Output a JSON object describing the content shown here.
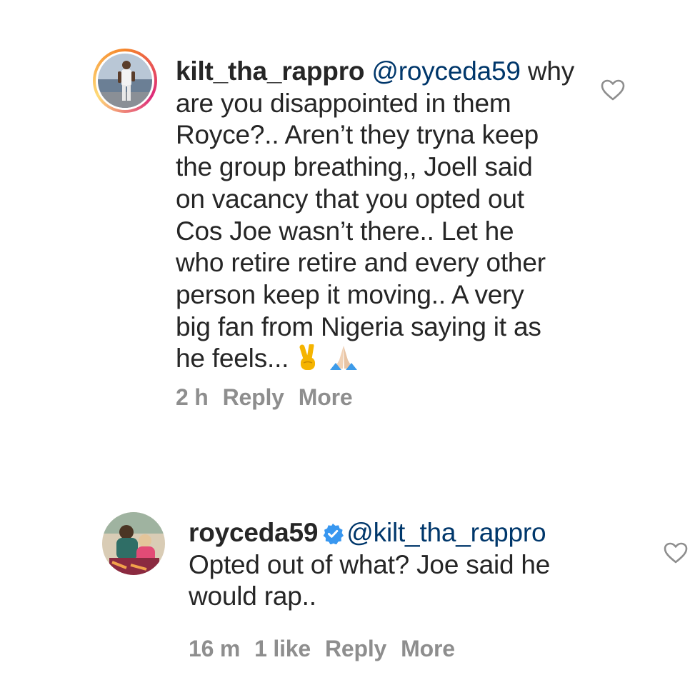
{
  "comments": [
    {
      "username": "kilt_tha_rappro",
      "mention": "@royceda59",
      "lines": [
        " why",
        "are you disappointed in them",
        "Royce?.. Aren’t they tryna keep",
        "the group breathing,, Joell said",
        "on vacancy that you opted out",
        "Cos Joe wasn’t there.. Let he",
        "who retire retire and every other",
        "person keep it moving.. A very",
        "big fan from Nigeria saying it as",
        "he feels..."
      ],
      "emojis": [
        "victory-hand",
        "folded-hands"
      ],
      "time": "2 h",
      "reply_label": "Reply",
      "more_label": "More",
      "like_icon": "heart-outline-icon"
    },
    {
      "username": "royceda59",
      "verified": true,
      "mention": "@kilt_tha_rappro",
      "lines": [
        "Opted out of what? Joe said he",
        "would rap.."
      ],
      "time": "16 m",
      "likes": "1 like",
      "reply_label": "Reply",
      "more_label": "More",
      "like_icon": "heart-outline-icon"
    }
  ],
  "colors": {
    "text": "#262626",
    "mention": "#00376b",
    "meta": "#8e8e8e",
    "verified": "#3897f0"
  }
}
